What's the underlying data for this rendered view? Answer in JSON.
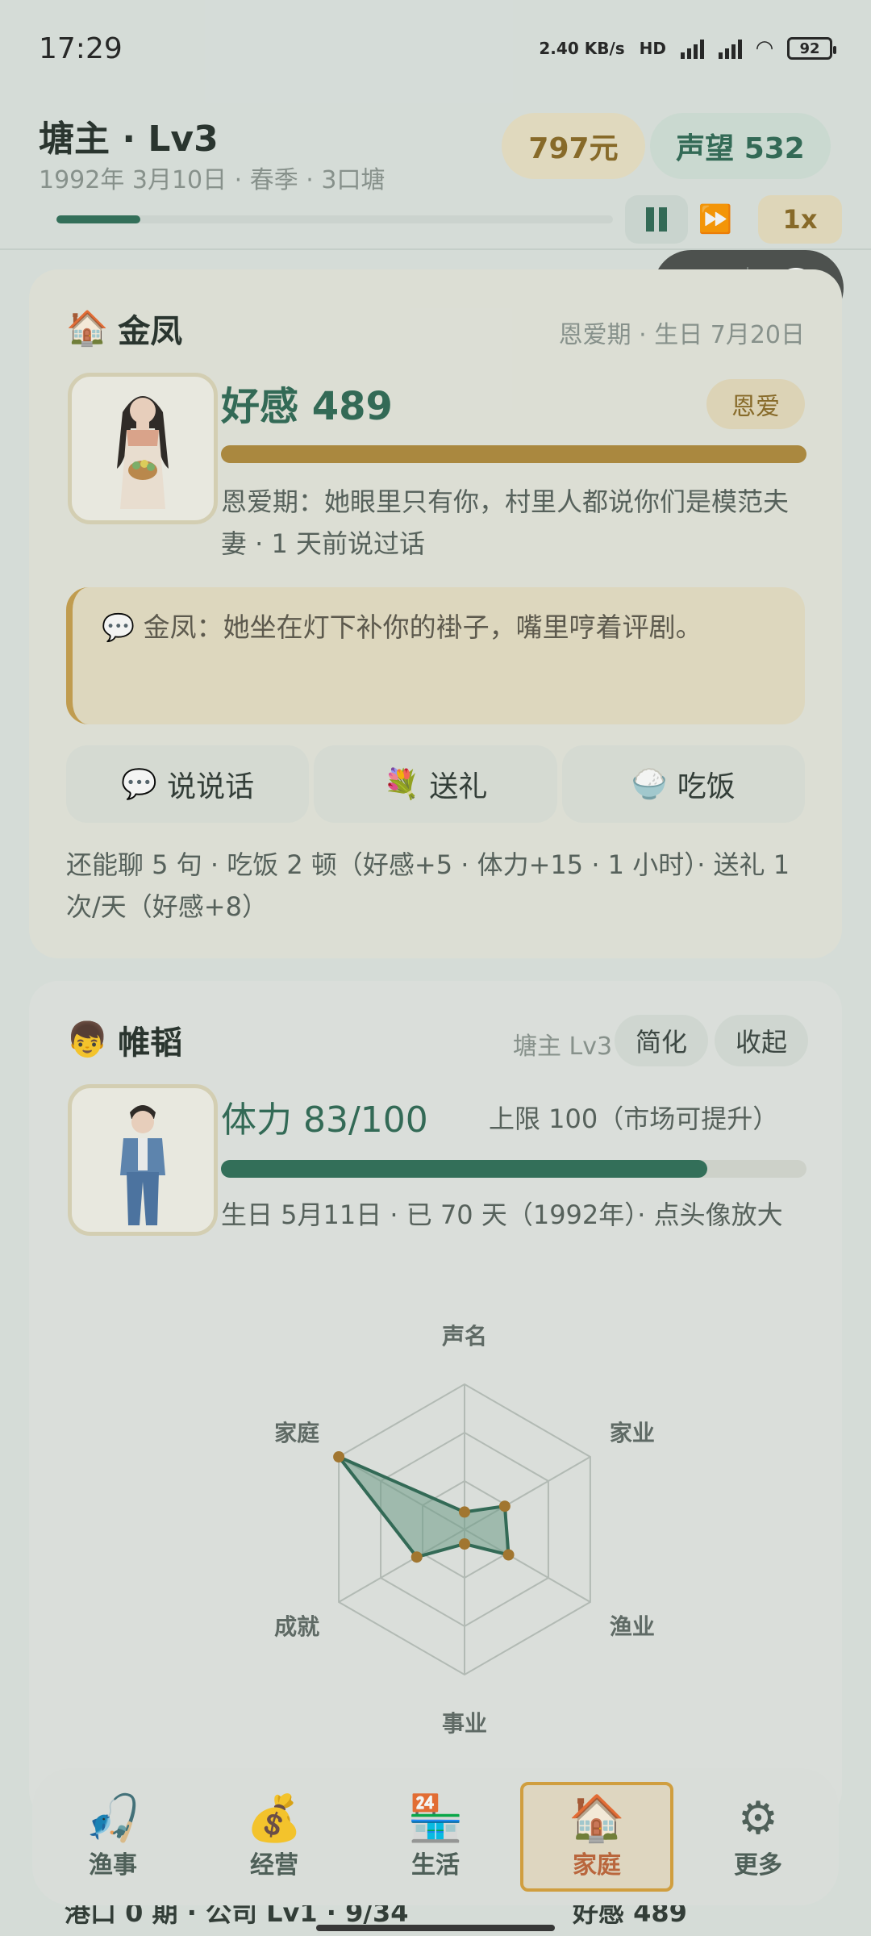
{
  "status_bar": {
    "time": "17:29",
    "net_speed": "2.40 KB/s",
    "battery": "92"
  },
  "header": {
    "title": "塘主 · Lv3",
    "subtitle": "1992年 3月10日 · 春季 · 3口塘",
    "money": "797元",
    "fame": "声望 532",
    "speed": "1x",
    "ff_icon": "fast-forward",
    "pause_icon": "pause"
  },
  "wife_card": {
    "icon": "🏠",
    "name": "金凤",
    "meta": "恩爱期 · 生日 7月20日",
    "favor": "好感 489",
    "tag": "恩爱",
    "favor_ratio": 1.0,
    "desc": "恩爱期：她眼里只有你，村里人都说你们是模范夫妻 · 1 天前说过话",
    "quote": "💬 金凤：她坐在灯下补你的褂子，嘴里哼着评剧。",
    "actions": [
      {
        "icon": "💬",
        "label": "说说话"
      },
      {
        "icon": "💐",
        "label": "送礼"
      },
      {
        "icon": "🍚",
        "label": "吃饭"
      }
    ],
    "note": "还能聊 5 句 · 吃饭 2 顿（好感+5 · 体力+15 · 1 小时）· 送礼 1 次/天（好感+8）"
  },
  "self_card": {
    "icon": "👦",
    "name": "帷韬",
    "level": "塘主 Lv3",
    "simplify": "简化",
    "collapse": "收起",
    "stamina": "体力 83/100",
    "stamina_ratio": 0.83,
    "limit": "上限 100（市场可提升）",
    "desc": "生日 5月11日 · 已 70 天（1992年）· 点头像放大"
  },
  "chart_data": {
    "type": "radar",
    "axes": [
      "声名",
      "家业",
      "渔业",
      "事业",
      "成就",
      "家庭"
    ],
    "values": [
      0.12,
      0.32,
      0.35,
      0.1,
      0.38,
      1.0
    ],
    "range": [
      0,
      1
    ],
    "levels": 3,
    "colors": {
      "fill": "#6f9f8b",
      "line": "#2f6a55",
      "point": "#a7772c",
      "grid": "#b9c0bb"
    }
  },
  "bottom_nav": [
    {
      "icon": "🎣",
      "label": "渔事",
      "active": false
    },
    {
      "icon": "💰",
      "label": "经营",
      "active": false
    },
    {
      "icon": "🏪",
      "label": "生活",
      "active": false
    },
    {
      "icon": "🏠",
      "label": "家庭",
      "active": true
    },
    {
      "icon": "⚙",
      "label": "更多",
      "active": false
    }
  ],
  "behind_text": {
    "left": "港口 0 期 · 公司 Lv1 · 9/34",
    "right": "好感 489"
  }
}
